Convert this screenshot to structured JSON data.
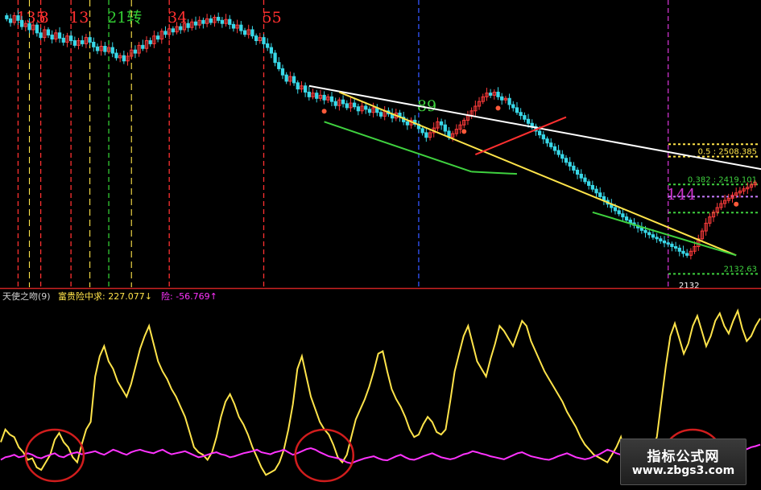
{
  "chart_data": [
    {
      "type": "candlestick",
      "description_of_values": "price series approximated from the image, no price axis shown",
      "colors": {
        "up": "#ff3b3b",
        "down": "#39d8e8",
        "trend_white": "#ffffff",
        "trend_yellow": "#ffe44a",
        "trend_green": "#3fd13f",
        "trend_red": "#ff3030",
        "fib_yellow": "#ffe44a",
        "fib_green": "#3fd13f",
        "fib_purple": "#c87bff",
        "time_line_purple": "#cc33cc",
        "time_line_yellow": "#ffe44a",
        "time_line_green": "#33cc33",
        "time_line_red": "#ff3030",
        "time_line_blue": "#3355ff"
      },
      "close": [
        2950,
        2938,
        2960,
        2945,
        2925,
        2935,
        2915,
        2930,
        2905,
        2890,
        2915,
        2898,
        2885,
        2905,
        2888,
        2875,
        2895,
        2880,
        2865,
        2880,
        2870,
        2890,
        2875,
        2860,
        2848,
        2862,
        2845,
        2858,
        2840,
        2825,
        2832,
        2815,
        2830,
        2850,
        2840,
        2865,
        2855,
        2880,
        2870,
        2895,
        2885,
        2910,
        2900,
        2918,
        2908,
        2925,
        2915,
        2935,
        2922,
        2940,
        2930,
        2945,
        2935,
        2950,
        2938,
        2955,
        2945,
        2935,
        2948,
        2932,
        2920,
        2930,
        2912,
        2900,
        2915,
        2895,
        2880,
        2890,
        2870,
        2858,
        2840,
        2810,
        2790,
        2770,
        2750,
        2765,
        2745,
        2725,
        2735,
        2715,
        2700,
        2712,
        2695,
        2705,
        2690,
        2700,
        2685,
        2672,
        2690,
        2678,
        2665,
        2680,
        2668,
        2655,
        2670,
        2660,
        2650,
        2665,
        2650,
        2638,
        2655,
        2645,
        2632,
        2648,
        2635,
        2620,
        2610,
        2625,
        2612,
        2598,
        2585,
        2570,
        2585,
        2600,
        2620,
        2610,
        2590,
        2570,
        2582,
        2596,
        2610,
        2625,
        2640,
        2655,
        2670,
        2685,
        2700,
        2712,
        2705,
        2715,
        2700,
        2690,
        2695,
        2675,
        2665,
        2650,
        2640,
        2628,
        2615,
        2605,
        2590,
        2578,
        2565,
        2552,
        2540,
        2528,
        2515,
        2503,
        2490,
        2478,
        2465,
        2452,
        2440,
        2428,
        2416,
        2404,
        2392,
        2380,
        2368,
        2356,
        2345,
        2335,
        2325,
        2315,
        2305,
        2296,
        2288,
        2280,
        2272,
        2265,
        2258,
        2250,
        2245,
        2238,
        2232,
        2228,
        2220,
        2215,
        2205,
        2198,
        2192,
        2205,
        2220,
        2245,
        2270,
        2295,
        2315,
        2330,
        2345,
        2358,
        2368,
        2375,
        2385,
        2392,
        2398,
        2405,
        2410,
        2418,
        2425
      ],
      "trend_lines": [
        {
          "name": "white",
          "from_bar": 80,
          "from_price": 2735,
          "to_bar": 219,
          "to_price": 2425
        },
        {
          "name": "yellow",
          "from_bar": 88,
          "from_price": 2715,
          "to_bar": 193,
          "to_price": 2192
        },
        {
          "name": "red",
          "from_bar": 124,
          "from_price": 2515,
          "to_bar": 148,
          "to_price": 2635
        },
        {
          "name": "green_1",
          "from_bar": 84,
          "from_price": 2620,
          "to_bar": 123,
          "to_price": 2460
        },
        {
          "name": "green_2",
          "from_bar": 123,
          "from_price": 2460,
          "to_bar": 135,
          "to_price": 2453
        },
        {
          "name": "green_3",
          "from_bar": 155,
          "from_price": 2330,
          "to_bar": 193,
          "to_price": 2192
        }
      ],
      "fib_levels": [
        {
          "label": "",
          "price": 2548,
          "color": "yellow"
        },
        {
          "label": "0.5 : 2508.385",
          "price": 2508.385,
          "color": "yellow"
        },
        {
          "label": "0.382 : 2419.101",
          "price": 2419.101,
          "color": "green"
        },
        {
          "label": "",
          "price": 2380,
          "color": "purple"
        },
        {
          "label": "",
          "price": 2329,
          "color": "green"
        },
        {
          "label": "2132.63",
          "price": 2132.63,
          "color": "green"
        }
      ],
      "time_lines": [
        {
          "bar": 3,
          "label": "135",
          "style": "red"
        },
        {
          "bar": 9,
          "label": "8",
          "style": "red"
        },
        {
          "bar": 17,
          "label": "13",
          "style": "red"
        },
        {
          "bar": 27,
          "label": "21转",
          "style": "green"
        },
        {
          "bar": 43,
          "label": "34",
          "style": "red"
        },
        {
          "bar": 68,
          "label": "55",
          "style": "red"
        },
        {
          "bar": 109,
          "label": "89",
          "style": "blue"
        },
        {
          "bar": 175,
          "label": "144",
          "style": "purple"
        }
      ],
      "low_markers": [
        84,
        121,
        130,
        193
      ],
      "min_price_label": "2132"
    },
    {
      "type": "line",
      "title": "天使之吻(9)",
      "legend": [
        {
          "label": "富贵险中求: 227.077↓",
          "color": "#ffe44a"
        },
        {
          "label": "险: -56.769↑",
          "color": "#ff33ff"
        }
      ],
      "series": [
        {
          "name": "富贵险中求",
          "color": "#ffe44a",
          "values": [
            70,
            95,
            85,
            80,
            60,
            50,
            35,
            38,
            20,
            15,
            30,
            45,
            75,
            88,
            70,
            60,
            40,
            30,
            65,
            95,
            110,
            200,
            240,
            260,
            230,
            215,
            190,
            175,
            160,
            185,
            220,
            255,
            280,
            300,
            265,
            230,
            210,
            195,
            175,
            160,
            140,
            120,
            90,
            60,
            50,
            45,
            35,
            50,
            80,
            120,
            150,
            165,
            145,
            120,
            105,
            85,
            60,
            40,
            20,
            5,
            10,
            15,
            30,
            55,
            95,
            145,
            215,
            240,
            200,
            160,
            135,
            110,
            95,
            85,
            65,
            40,
            30,
            45,
            80,
            115,
            135,
            155,
            180,
            210,
            245,
            250,
            210,
            175,
            155,
            140,
            120,
            95,
            80,
            85,
            105,
            120,
            110,
            90,
            85,
            95,
            150,
            210,
            245,
            280,
            300,
            265,
            230,
            215,
            200,
            235,
            265,
            300,
            290,
            275,
            260,
            285,
            310,
            300,
            270,
            250,
            230,
            210,
            195,
            180,
            165,
            150,
            130,
            115,
            100,
            80,
            65,
            55,
            45,
            40,
            35,
            30,
            45,
            60,
            80,
            40,
            25,
            15,
            20,
            30,
            45,
            60,
            80,
            150,
            220,
            280,
            305,
            275,
            245,
            265,
            300,
            320,
            290,
            260,
            280,
            310,
            325,
            300,
            285,
            310,
            330,
            295,
            270,
            280,
            300,
            315
          ],
          "approx": true
        },
        {
          "name": "险",
          "color": "#ff33ff",
          "values": [
            35,
            40,
            42,
            45,
            40,
            42,
            48,
            45,
            40,
            38,
            42,
            45,
            48,
            42,
            40,
            45,
            48,
            50,
            46,
            48,
            50,
            52,
            48,
            45,
            50,
            55,
            52,
            48,
            45,
            50,
            53,
            55,
            52,
            50,
            48,
            52,
            55,
            50,
            46,
            48,
            50,
            52,
            48,
            44,
            40,
            42,
            45,
            48,
            50,
            46,
            44,
            40,
            42,
            45,
            48,
            50,
            52,
            55,
            50,
            48,
            46,
            50,
            52,
            55,
            50,
            45,
            48,
            52,
            56,
            58,
            55,
            50,
            46,
            42,
            40,
            38,
            35,
            30,
            28,
            32,
            35,
            38,
            40,
            42,
            38,
            35,
            34,
            38,
            42,
            45,
            40,
            36,
            35,
            38,
            42,
            45,
            48,
            44,
            40,
            38,
            36,
            38,
            42,
            46,
            48,
            52,
            50,
            47,
            45,
            42,
            40,
            38,
            36,
            40,
            44,
            48,
            50,
            46,
            42,
            40,
            38,
            36,
            35,
            38,
            42,
            45,
            48,
            44,
            40,
            38,
            36,
            38,
            42,
            45,
            50,
            55,
            52,
            48,
            45,
            50,
            55,
            52,
            48,
            46,
            50,
            54,
            58,
            55,
            52,
            50,
            54,
            58,
            62,
            60,
            56,
            54,
            58,
            62,
            60,
            56,
            55,
            58,
            62,
            64,
            60,
            58,
            56,
            60,
            62,
            65
          ],
          "approx": true
        }
      ],
      "circles": [
        {
          "center_index": 12
        },
        {
          "center_index": 72
        },
        {
          "center_index": 154
        }
      ]
    }
  ],
  "watermark": {
    "title": "指标公式网",
    "url": "www.zbgs3.com"
  }
}
